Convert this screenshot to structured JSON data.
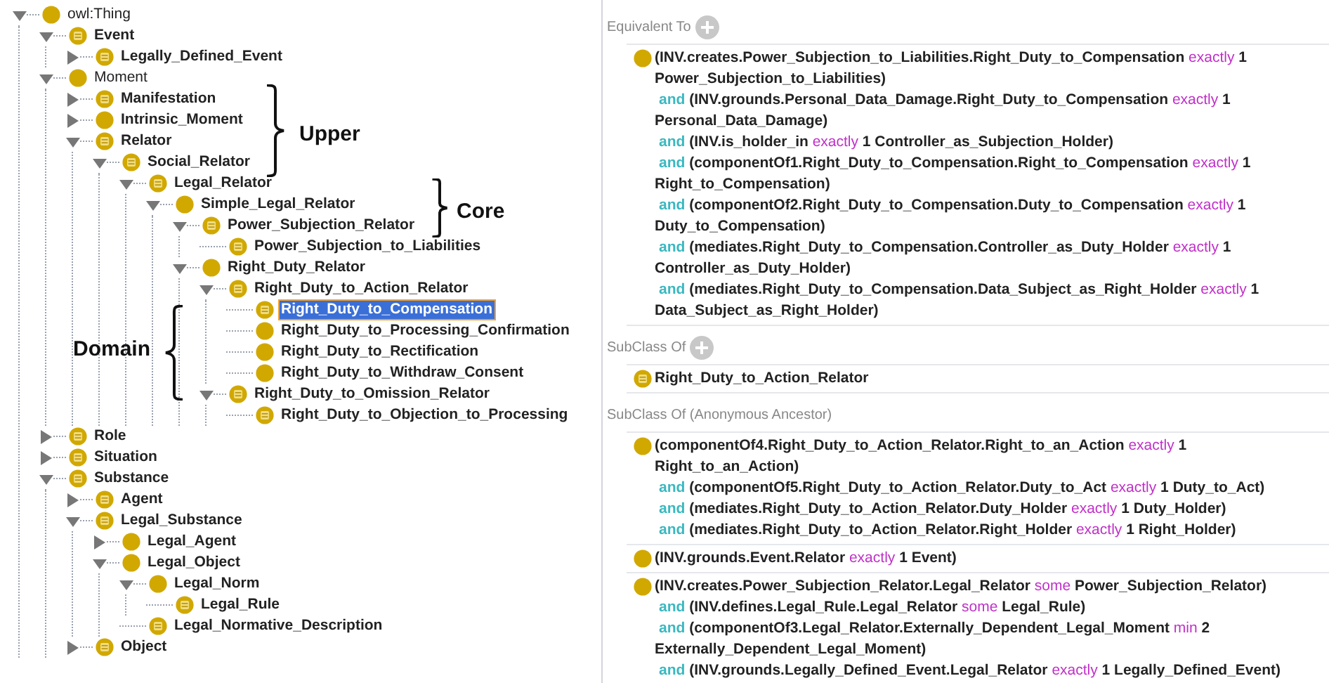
{
  "tree": [
    {
      "label": "owl:Thing",
      "kind": "primitive",
      "bold": false,
      "expanded": true,
      "selected": false,
      "children": [
        {
          "label": "Event",
          "kind": "defined",
          "bold": true,
          "expanded": true,
          "selected": false,
          "children": [
            {
              "label": "Legally_Defined_Event",
              "kind": "defined",
              "bold": true,
              "expanded": false,
              "selected": false
            }
          ]
        },
        {
          "label": "Moment",
          "kind": "primitive",
          "bold": false,
          "expanded": true,
          "selected": false,
          "children": [
            {
              "label": "Manifestation",
              "kind": "defined",
              "bold": true,
              "expanded": false,
              "selected": false
            },
            {
              "label": "Intrinsic_Moment",
              "kind": "primitive",
              "bold": true,
              "expanded": false,
              "selected": false
            },
            {
              "label": "Relator",
              "kind": "defined",
              "bold": true,
              "expanded": true,
              "selected": false,
              "children": [
                {
                  "label": "Social_Relator",
                  "kind": "defined",
                  "bold": true,
                  "expanded": true,
                  "selected": false,
                  "children": [
                    {
                      "label": "Legal_Relator",
                      "kind": "defined",
                      "bold": true,
                      "expanded": true,
                      "selected": false,
                      "children": [
                        {
                          "label": "Simple_Legal_Relator",
                          "kind": "primitive",
                          "bold": true,
                          "expanded": true,
                          "selected": false,
                          "children": [
                            {
                              "label": "Power_Subjection_Relator",
                              "kind": "defined",
                              "bold": true,
                              "expanded": true,
                              "selected": false,
                              "children": [
                                {
                                  "label": "Power_Subjection_to_Liabilities",
                                  "kind": "defined",
                                  "bold": true,
                                  "selected": false
                                }
                              ]
                            },
                            {
                              "label": "Right_Duty_Relator",
                              "kind": "primitive",
                              "bold": true,
                              "expanded": true,
                              "selected": false,
                              "children": [
                                {
                                  "label": "Right_Duty_to_Action_Relator",
                                  "kind": "defined",
                                  "bold": true,
                                  "expanded": true,
                                  "selected": false,
                                  "children": [
                                    {
                                      "label": "Right_Duty_to_Compensation",
                                      "kind": "defined",
                                      "bold": true,
                                      "selected": true
                                    },
                                    {
                                      "label": "Right_Duty_to_Processing_Confirmation",
                                      "kind": "primitive",
                                      "bold": true,
                                      "selected": false
                                    },
                                    {
                                      "label": "Right_Duty_to_Rectification",
                                      "kind": "primitive",
                                      "bold": true,
                                      "selected": false
                                    },
                                    {
                                      "label": "Right_Duty_to_Withdraw_Consent",
                                      "kind": "primitive",
                                      "bold": true,
                                      "selected": false
                                    }
                                  ]
                                },
                                {
                                  "label": "Right_Duty_to_Omission_Relator",
                                  "kind": "defined",
                                  "bold": true,
                                  "expanded": true,
                                  "selected": false,
                                  "children": [
                                    {
                                      "label": "Right_Duty_to_Objection_to_Processing",
                                      "kind": "defined",
                                      "bold": true,
                                      "selected": false
                                    }
                                  ]
                                }
                              ]
                            }
                          ]
                        }
                      ]
                    }
                  ]
                }
              ]
            }
          ]
        },
        {
          "label": "Role",
          "kind": "defined",
          "bold": true,
          "expanded": false,
          "selected": false
        },
        {
          "label": "Situation",
          "kind": "defined",
          "bold": true,
          "expanded": false,
          "selected": false
        },
        {
          "label": "Substance",
          "kind": "defined",
          "bold": true,
          "expanded": true,
          "selected": false,
          "children": [
            {
              "label": "Agent",
              "kind": "defined",
              "bold": true,
              "expanded": false,
              "selected": false
            },
            {
              "label": "Legal_Substance",
              "kind": "defined",
              "bold": true,
              "expanded": true,
              "selected": false,
              "children": [
                {
                  "label": "Legal_Agent",
                  "kind": "primitive",
                  "bold": true,
                  "expanded": false,
                  "selected": false
                },
                {
                  "label": "Legal_Object",
                  "kind": "primitive",
                  "bold": true,
                  "expanded": true,
                  "selected": false,
                  "children": [
                    {
                      "label": "Legal_Norm",
                      "kind": "primitive",
                      "bold": true,
                      "expanded": true,
                      "selected": false,
                      "children": [
                        {
                          "label": "Legal_Rule",
                          "kind": "defined",
                          "bold": true,
                          "selected": false
                        }
                      ]
                    },
                    {
                      "label": "Legal_Normative_Description",
                      "kind": "defined",
                      "bold": true,
                      "selected": false
                    }
                  ]
                }
              ]
            },
            {
              "label": "Object",
              "kind": "defined",
              "bold": true,
              "expanded": false,
              "selected": false
            }
          ]
        }
      ]
    }
  ],
  "annotations": [
    {
      "label": "Upper"
    },
    {
      "label": "Core"
    },
    {
      "label": "Domain"
    }
  ],
  "sections": [
    {
      "title": "Equivalent To",
      "addable": true,
      "items": [
        {
          "kind": "primitive",
          "lines": [
            [
              {
                "text": "(INV.creates.Power_Subjection_to_Liabilities.Right_Duty_to_Compensation ",
                "kind": "class"
              },
              {
                "text": "exactly",
                "kind": "keyword"
              },
              {
                "text": " 1",
                "kind": "class"
              }
            ],
            [
              {
                "text": "Power_Subjection_to_Liabilities)",
                "kind": "class"
              }
            ],
            [
              {
                "text": "and",
                "kind": "connective"
              },
              {
                "text": " (INV.grounds.Personal_Data_Damage.Right_Duty_to_Compensation ",
                "kind": "class"
              },
              {
                "text": "exactly",
                "kind": "keyword"
              },
              {
                "text": " 1",
                "kind": "class"
              }
            ],
            [
              {
                "text": "Personal_Data_Damage)",
                "kind": "class"
              }
            ],
            [
              {
                "text": "and",
                "kind": "connective"
              },
              {
                "text": " (INV.is_holder_in ",
                "kind": "class"
              },
              {
                "text": "exactly",
                "kind": "keyword"
              },
              {
                "text": " 1 Controller_as_Subjection_Holder)",
                "kind": "class"
              }
            ],
            [
              {
                "text": "and",
                "kind": "connective"
              },
              {
                "text": " (componentOf1.Right_Duty_to_Compensation.Right_to_Compensation ",
                "kind": "class"
              },
              {
                "text": "exactly",
                "kind": "keyword"
              },
              {
                "text": " 1",
                "kind": "class"
              }
            ],
            [
              {
                "text": "Right_to_Compensation)",
                "kind": "class"
              }
            ],
            [
              {
                "text": "and",
                "kind": "connective"
              },
              {
                "text": " (componentOf2.Right_Duty_to_Compensation.Duty_to_Compensation ",
                "kind": "class"
              },
              {
                "text": "exactly",
                "kind": "keyword"
              },
              {
                "text": " 1",
                "kind": "class"
              }
            ],
            [
              {
                "text": "Duty_to_Compensation)",
                "kind": "class"
              }
            ],
            [
              {
                "text": "and",
                "kind": "connective"
              },
              {
                "text": " (mediates.Right_Duty_to_Compensation.Controller_as_Duty_Holder ",
                "kind": "class"
              },
              {
                "text": "exactly",
                "kind": "keyword"
              },
              {
                "text": " 1",
                "kind": "class"
              }
            ],
            [
              {
                "text": "Controller_as_Duty_Holder)",
                "kind": "class"
              }
            ],
            [
              {
                "text": "and",
                "kind": "connective"
              },
              {
                "text": " (mediates.Right_Duty_to_Compensation.Data_Subject_as_Right_Holder ",
                "kind": "class"
              },
              {
                "text": "exactly",
                "kind": "keyword"
              },
              {
                "text": " 1",
                "kind": "class"
              }
            ],
            [
              {
                "text": "Data_Subject_as_Right_Holder)",
                "kind": "class"
              }
            ]
          ]
        }
      ]
    },
    {
      "title": "SubClass Of",
      "addable": true,
      "items": [
        {
          "kind": "defined",
          "lines": [
            [
              {
                "text": "Right_Duty_to_Action_Relator",
                "kind": "class"
              }
            ]
          ]
        }
      ]
    },
    {
      "title": "SubClass Of (Anonymous Ancestor)",
      "addable": false,
      "items": [
        {
          "kind": "primitive",
          "lines": [
            [
              {
                "text": "(componentOf4.Right_Duty_to_Action_Relator.Right_to_an_Action ",
                "kind": "class"
              },
              {
                "text": "exactly",
                "kind": "keyword"
              },
              {
                "text": " 1",
                "kind": "class"
              }
            ],
            [
              {
                "text": "Right_to_an_Action)",
                "kind": "class"
              }
            ],
            [
              {
                "text": "and",
                "kind": "connective"
              },
              {
                "text": " (componentOf5.Right_Duty_to_Action_Relator.Duty_to_Act ",
                "kind": "class"
              },
              {
                "text": "exactly",
                "kind": "keyword"
              },
              {
                "text": " 1 Duty_to_Act)",
                "kind": "class"
              }
            ],
            [
              {
                "text": "and",
                "kind": "connective"
              },
              {
                "text": " (mediates.Right_Duty_to_Action_Relator.Duty_Holder ",
                "kind": "class"
              },
              {
                "text": "exactly",
                "kind": "keyword"
              },
              {
                "text": " 1 Duty_Holder)",
                "kind": "class"
              }
            ],
            [
              {
                "text": "and",
                "kind": "connective"
              },
              {
                "text": " (mediates.Right_Duty_to_Action_Relator.Right_Holder ",
                "kind": "class"
              },
              {
                "text": "exactly",
                "kind": "keyword"
              },
              {
                "text": " 1 Right_Holder)",
                "kind": "class"
              }
            ]
          ]
        },
        {
          "kind": "primitive",
          "lines": [
            [
              {
                "text": "(INV.grounds.Event.Relator ",
                "kind": "class"
              },
              {
                "text": "exactly",
                "kind": "keyword"
              },
              {
                "text": " 1 Event)",
                "kind": "class"
              }
            ]
          ]
        },
        {
          "kind": "primitive",
          "lines": [
            [
              {
                "text": "(INV.creates.Power_Subjection_Relator.Legal_Relator ",
                "kind": "class"
              },
              {
                "text": "some",
                "kind": "keyword"
              },
              {
                "text": " Power_Subjection_Relator)",
                "kind": "class"
              }
            ],
            [
              {
                "text": "and",
                "kind": "connective"
              },
              {
                "text": " (INV.defines.Legal_Rule.Legal_Relator ",
                "kind": "class"
              },
              {
                "text": "some",
                "kind": "keyword"
              },
              {
                "text": " Legal_Rule)",
                "kind": "class"
              }
            ],
            [
              {
                "text": "and",
                "kind": "connective"
              },
              {
                "text": " (componentOf3.Legal_Relator.Externally_Dependent_Legal_Moment ",
                "kind": "class"
              },
              {
                "text": "min",
                "kind": "keyword"
              },
              {
                "text": " 2",
                "kind": "class"
              }
            ],
            [
              {
                "text": "Externally_Dependent_Legal_Moment)",
                "kind": "class"
              }
            ],
            [
              {
                "text": "and",
                "kind": "connective"
              },
              {
                "text": " (INV.grounds.Legally_Defined_Event.Legal_Relator ",
                "kind": "class"
              },
              {
                "text": "exactly",
                "kind": "keyword"
              },
              {
                "text": " 1 Legally_Defined_Event)",
                "kind": "class"
              }
            ]
          ]
        }
      ]
    }
  ]
}
